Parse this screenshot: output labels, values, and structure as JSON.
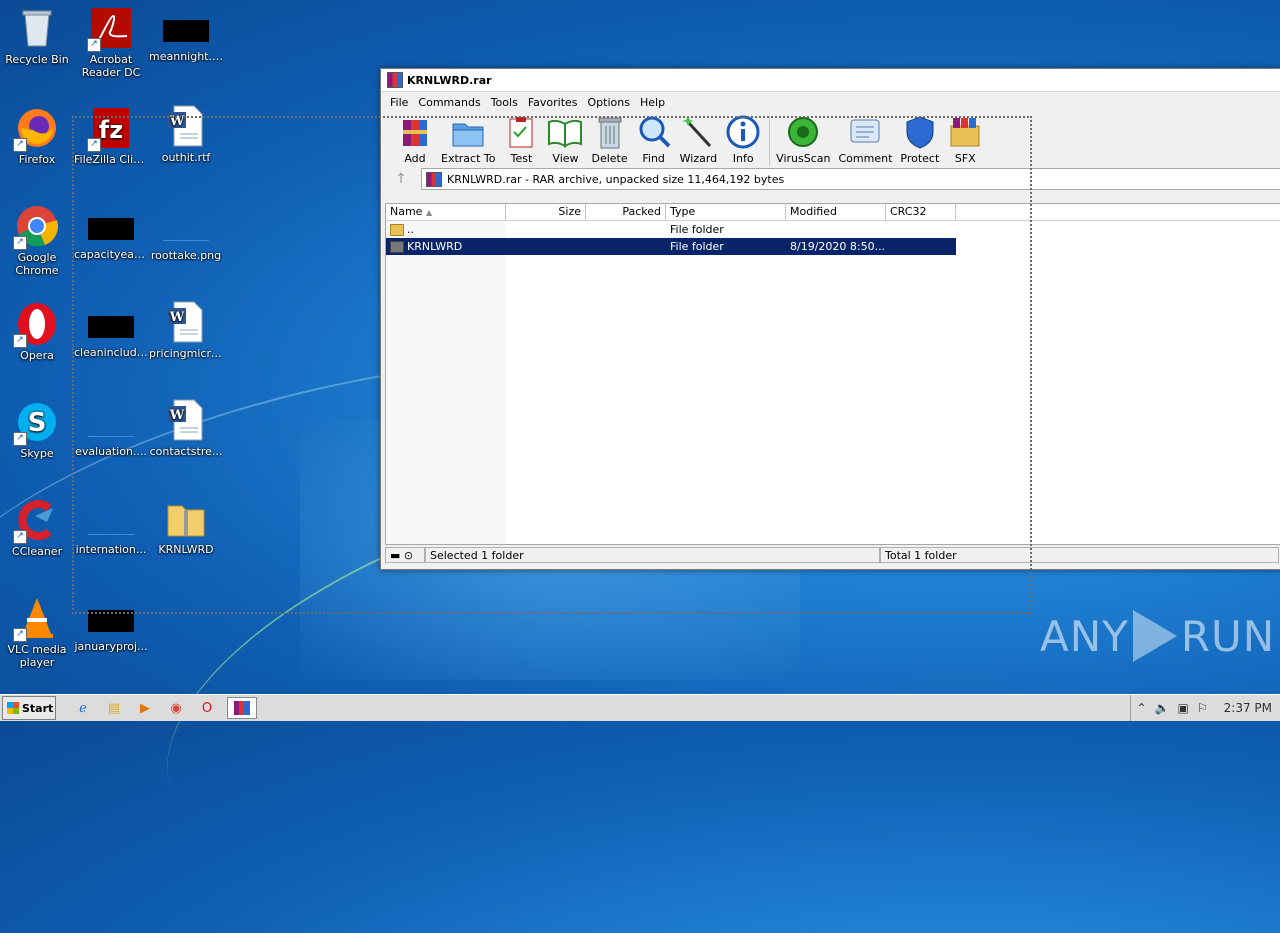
{
  "desktop": {
    "icons": [
      {
        "label": "Recycle Bin"
      },
      {
        "label": "Acrobat Reader DC"
      },
      {
        "label": "meannight.jpg"
      },
      {
        "label": "Firefox"
      },
      {
        "label": "FileZilla Client"
      },
      {
        "label": "outhit.rtf"
      },
      {
        "label": "Google Chrome"
      },
      {
        "label": "capacityeac..."
      },
      {
        "label": "roottake.png"
      },
      {
        "label": "Opera"
      },
      {
        "label": "cleaninclude..."
      },
      {
        "label": "pricingmicro..."
      },
      {
        "label": "Skype"
      },
      {
        "label": "evaluation...."
      },
      {
        "label": "contactstre..."
      },
      {
        "label": "CCleaner"
      },
      {
        "label": "internation..."
      },
      {
        "label": "KRNLWRD"
      },
      {
        "label": "VLC media player"
      },
      {
        "label": "januaryproj..."
      }
    ]
  },
  "winrar": {
    "title": "KRNLWRD.rar",
    "menu": [
      "File",
      "Commands",
      "Tools",
      "Favorites",
      "Options",
      "Help"
    ],
    "toolbar": [
      "Add",
      "Extract To",
      "Test",
      "View",
      "Delete",
      "Find",
      "Wizard",
      "Info",
      "VirusScan",
      "Comment",
      "Protect",
      "SFX"
    ],
    "address": "KRNLWRD.rar - RAR archive, unpacked size 11,464,192 bytes",
    "columns": [
      "Name",
      "Size",
      "Packed",
      "Type",
      "Modified",
      "CRC32"
    ],
    "rows": [
      {
        "name": "..",
        "size": "",
        "packed": "",
        "type": "File folder",
        "modified": "",
        "crc": ""
      },
      {
        "name": "KRNLWRD",
        "size": "",
        "packed": "",
        "type": "File folder",
        "modified": "8/19/2020 8:50...",
        "crc": ""
      }
    ],
    "status_left": "Selected 1 folder",
    "status_right": "Total 1 folder"
  },
  "taskbar": {
    "start": "Start",
    "clock": "2:37 PM"
  },
  "watermark": {
    "left": "ANY",
    "right": "RUN"
  }
}
